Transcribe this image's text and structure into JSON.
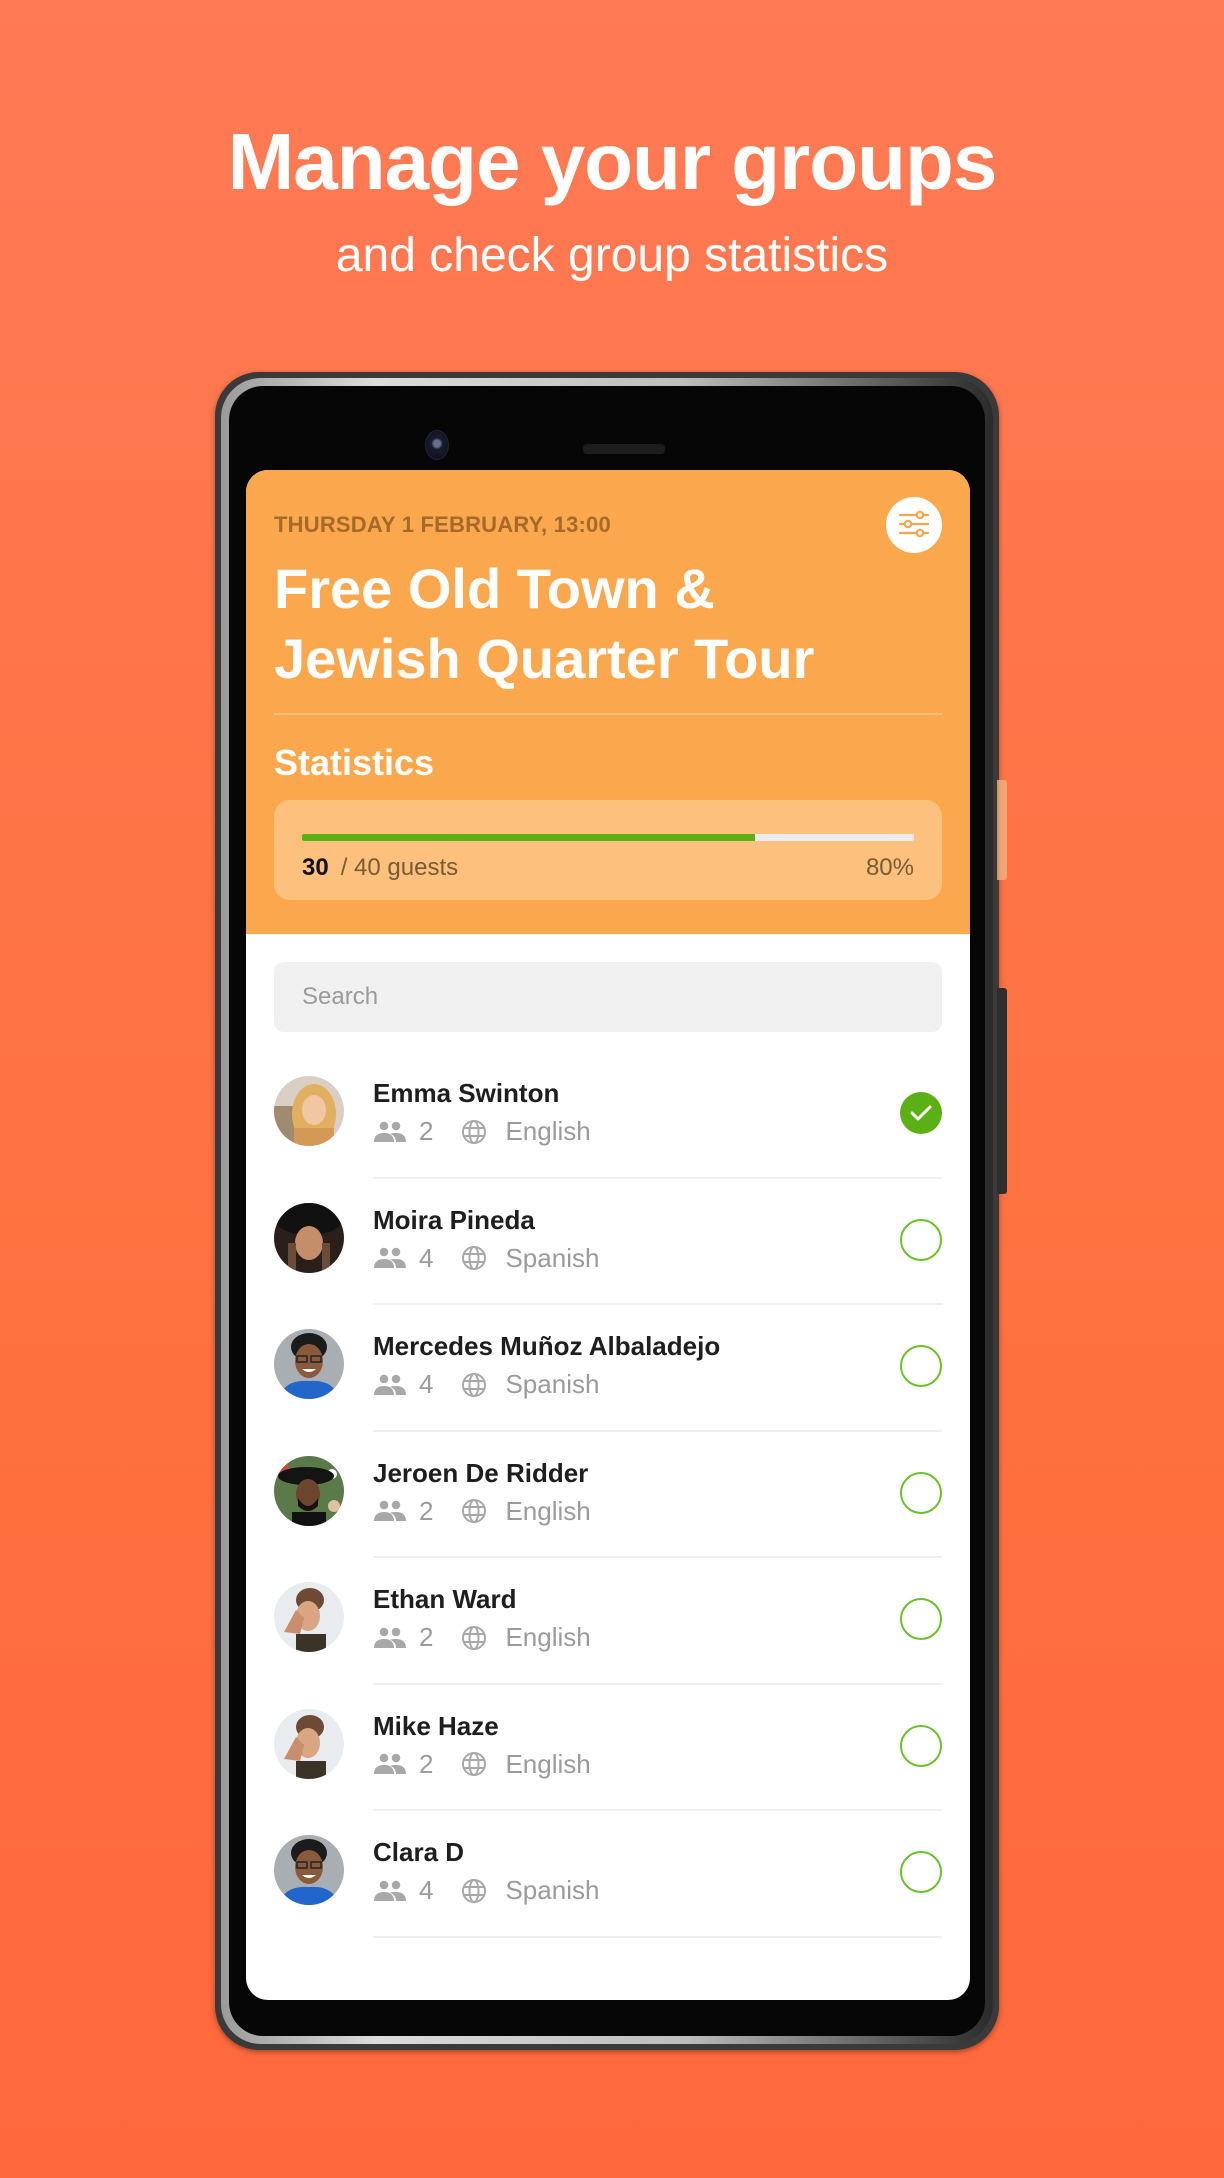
{
  "promo": {
    "title": "Manage your groups",
    "subtitle": "and check group statistics"
  },
  "tour": {
    "date": "THURSDAY 1 FEBRUARY, 13:00",
    "title": "Free Old Town & Jewish Quarter Tour",
    "filter_icon": "sliders-icon"
  },
  "statistics": {
    "heading": "Statistics",
    "checked_in": "30",
    "total_label": "/ 40 guests",
    "percent_label": "80%",
    "progress_percent": 74
  },
  "search": {
    "placeholder": "Search",
    "value": ""
  },
  "colors": {
    "header": "#FBA74D",
    "accent_green": "#5BB016",
    "background_top": "#FF7A55",
    "background_bottom": "#FF683D"
  },
  "guests": [
    {
      "name": "Emma Swinton",
      "group_size": "2",
      "language": "English",
      "checked": true,
      "avatar": "blonde-woman"
    },
    {
      "name": "Moira Pineda",
      "group_size": "4",
      "language": "Spanish",
      "checked": false,
      "avatar": "woman-black-hat"
    },
    {
      "name": "Mercedes Muñoz Albaladejo",
      "group_size": "4",
      "language": "Spanish",
      "checked": false,
      "avatar": "man-glasses-blue"
    },
    {
      "name": "Jeroen De Ridder",
      "group_size": "2",
      "language": "English",
      "checked": false,
      "avatar": "man-hat-floral"
    },
    {
      "name": "Ethan Ward",
      "group_size": "2",
      "language": "English",
      "checked": false,
      "avatar": "person-hand-face"
    },
    {
      "name": "Mike Haze",
      "group_size": "2",
      "language": "English",
      "checked": false,
      "avatar": "person-hand-face"
    },
    {
      "name": "Clara D",
      "group_size": "4",
      "language": "Spanish",
      "checked": false,
      "avatar": "man-glasses-blue"
    }
  ]
}
